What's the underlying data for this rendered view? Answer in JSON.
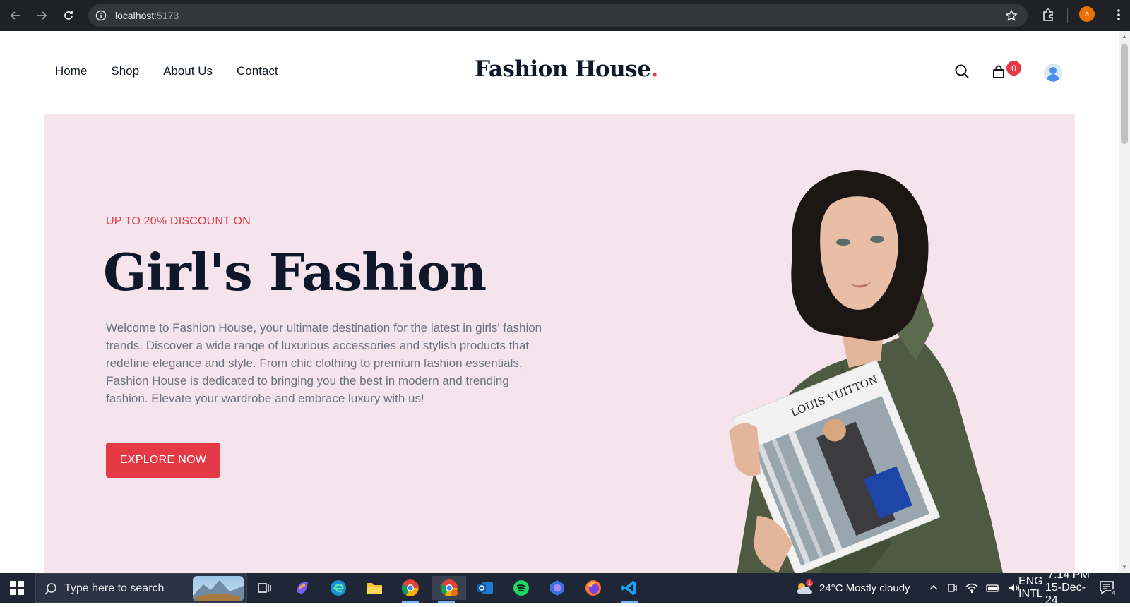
{
  "browser": {
    "url_host": "localhost",
    "url_port": ":5173",
    "profile_initial": "a"
  },
  "header": {
    "nav": [
      "Home",
      "Shop",
      "About Us",
      "Contact"
    ],
    "brand": "Fashion House",
    "brand_dot": ".",
    "cart_count": "0"
  },
  "hero": {
    "eyebrow": "UP TO 20% DISCOUNT ON",
    "title": "Girl's Fashion",
    "description": "Welcome to Fashion House, your ultimate destination for the latest in girls' fashion trends. Discover a wide range of luxurious accessories and stylish products that redefine elegance and style. From chic clothing to premium fashion essentials, Fashion House is dedicated to bringing you the best in modern and trending fashion. Elevate your wardrobe and embrace luxury with us!",
    "cta": "EXPLORE NOW",
    "magazine_text": "LOUIS VUITTON"
  },
  "colors": {
    "accent": "#e63946",
    "hero_bg": "#f5e4ec",
    "heading": "#0f172a"
  },
  "taskbar": {
    "search_placeholder": "Type here to search",
    "weather_badge": "1",
    "weather": "24°C  Mostly cloudy",
    "lang_top": "ENG",
    "lang_bottom": "INTL",
    "time": "7:14 PM",
    "date": "15-Dec-24",
    "notifications": "4",
    "apps": [
      "task-view-icon",
      "copilot-icon",
      "edge-icon",
      "file-explorer-icon",
      "chrome-icon",
      "chrome-profile-icon",
      "outlook-icon",
      "spotify-icon",
      "pc-manager-icon",
      "firefox-icon",
      "vscode-icon"
    ]
  }
}
